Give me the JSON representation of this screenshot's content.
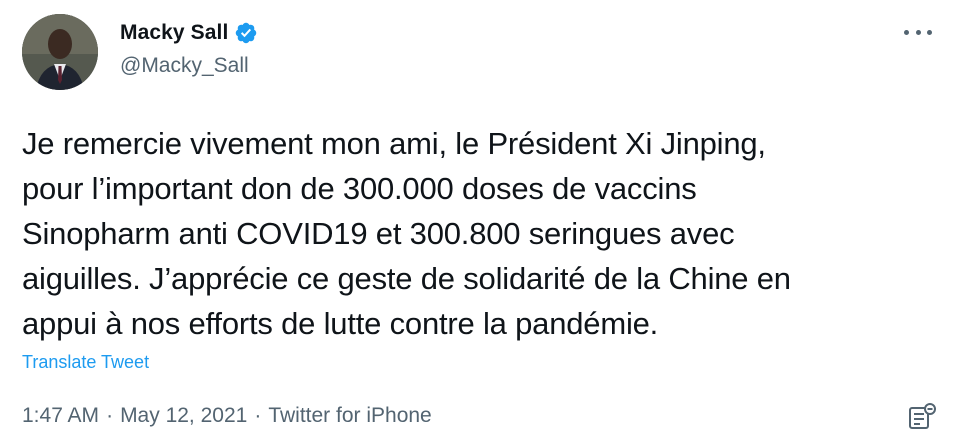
{
  "tweet": {
    "author": {
      "display_name": "Macky Sall",
      "handle": "@Macky_Sall",
      "verified": true,
      "avatar_icon": "profile-photo"
    },
    "text": "Je remercie vivement mon ami, le Président Xi Jinping,\npour l’important don de 300.000 doses de vaccins\nSinopharm anti COVID19 et 300.800 seringues avec\naiguilles. J’apprécie ce geste de solidarité de la Chine en\nappui à nos efforts de lutte contre la pandémie.",
    "translate_label": "Translate Tweet",
    "time": "1:47 AM",
    "separator": "·",
    "date": "May 12, 2021",
    "source": "Twitter for iPhone",
    "more_icon": "more-options-icon",
    "analytics_icon": "tweet-analytics-icon"
  },
  "colors": {
    "text": "#0f1419",
    "secondary": "#536471",
    "link": "#1d9bf0",
    "verified": "#1d9bf0"
  }
}
